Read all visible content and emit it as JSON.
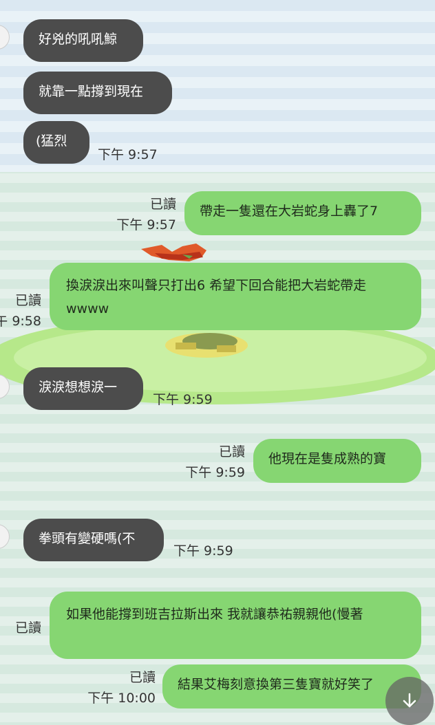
{
  "messages": [
    {
      "side": "in",
      "text": "好兇的吼吼鯨"
    },
    {
      "side": "in",
      "text": "就靠一點撐到現在"
    },
    {
      "side": "in",
      "text": "(猛烈",
      "time": "下午 9:57"
    },
    {
      "side": "out",
      "text": "帶走一隻還在大岩蛇身上轟了7",
      "read": "已讀",
      "time": "下午 9:57"
    },
    {
      "side": "out",
      "text": "換淚淚出來叫聲只打出6 希望下回合能把大岩蛇帶走wwww",
      "read": "已讀",
      "time": "下午 9:58"
    },
    {
      "side": "in",
      "text": "淚淚想想淚一",
      "time": "下午 9:59"
    },
    {
      "side": "out",
      "text": "他現在是隻成熟的寶",
      "read": "已讀",
      "time": "下午 9:59"
    },
    {
      "side": "in",
      "text": "拳頭有變硬嗎(不",
      "time": "下午 9:59"
    },
    {
      "side": "out",
      "text": "如果他能撐到班吉拉斯出來 我就讓恭祐親親他(慢著",
      "read": "已讀"
    },
    {
      "side": "out",
      "text": "結果艾梅刻意換第三隻寶就好笑了",
      "read": "已讀",
      "time": "下午 10:00"
    }
  ],
  "icons": {
    "scroll": "arrow-down-icon",
    "avatar": "avatar-icon"
  },
  "colors": {
    "incoming": "#4c4c4c",
    "outgoing": "#86d672"
  }
}
